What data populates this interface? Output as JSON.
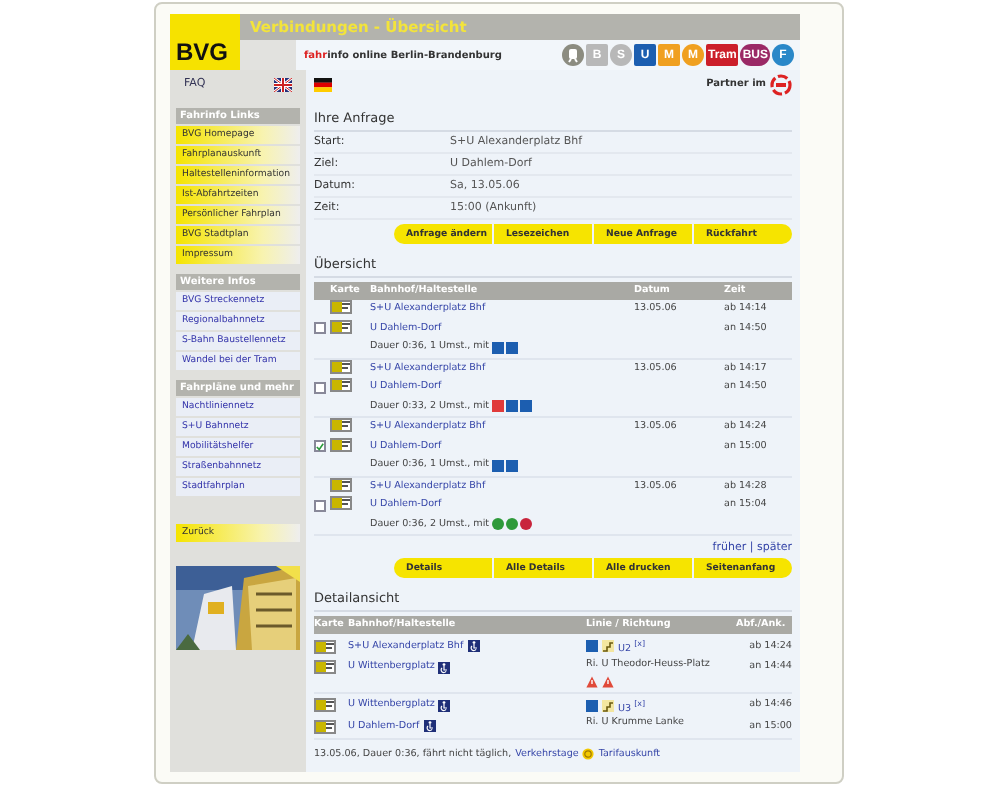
{
  "header": {
    "logo": "BVG",
    "title": "Verbindungen - Übersicht",
    "tagline_brand": "fahr",
    "tagline": "info online Berlin-Brandenburg",
    "modes": [
      {
        "kind": "train",
        "color": "#8c8c80"
      },
      {
        "kind": "square",
        "label": "B",
        "color": "#b8b8b8"
      },
      {
        "kind": "circle",
        "label": "S",
        "color": "#b8b8b8"
      },
      {
        "kind": "square",
        "label": "U",
        "color": "#1c5eb0"
      },
      {
        "kind": "square",
        "label": "M",
        "color": "#f0a020"
      },
      {
        "kind": "circle",
        "label": "M",
        "color": "#f0a020"
      },
      {
        "kind": "square",
        "label": "Tram",
        "color": "#cc1f2a"
      },
      {
        "kind": "circle",
        "label": "BUS",
        "color": "#9b2a66"
      },
      {
        "kind": "circle",
        "label": "F",
        "color": "#2a88c8"
      }
    ],
    "faq": "FAQ",
    "partner": "Partner im"
  },
  "sidebar": {
    "sections": [
      {
        "title": "Fahrinfo Links",
        "kind": "highlight",
        "items": [
          "BVG Homepage",
          "Fahrplanauskunft",
          "Haltestelleninformation",
          "Ist-Abfahrtzeiten",
          "Persönlicher Fahrplan",
          "BVG Stadtplan",
          "Impressum"
        ]
      },
      {
        "title": "Weitere Infos",
        "kind": "link",
        "items": [
          "BVG Streckennetz",
          "Regionalbahnnetz",
          "S-Bahn Baustellennetz",
          "Wandel bei der Tram"
        ]
      },
      {
        "title": "Fahrpläne und mehr",
        "kind": "link",
        "items": [
          "Nachtliniennetz",
          "S+U Bahnnetz",
          "Mobilitätshelfer",
          "Straßenbahnnetz",
          "Stadtfahrplan"
        ]
      }
    ],
    "back": "Zurück"
  },
  "request": {
    "title": "Ihre Anfrage",
    "fields": [
      {
        "label": "Start:",
        "value": "S+U Alexanderplatz Bhf"
      },
      {
        "label": "Ziel:",
        "value": "U Dahlem-Dorf"
      },
      {
        "label": "Datum:",
        "value": "Sa, 13.05.06"
      },
      {
        "label": "Zeit:",
        "value": "15:00 (Ankunft)"
      }
    ],
    "buttons": [
      "Anfrage ändern",
      "Lesezeichen",
      "Neue Anfrage",
      "Rückfahrt"
    ]
  },
  "overview": {
    "title": "Übersicht",
    "columns": [
      "Karte",
      "Bahnhof/Haltestelle",
      "Datum",
      "Zeit"
    ],
    "rows": [
      {
        "checked": false,
        "from": "S+U Alexanderplatz Bhf",
        "to": "U Dahlem-Dorf",
        "date": "13.05.06",
        "dep": "ab 14:14",
        "arr": "an 14:50",
        "summary": "Dauer 0:36, 1 Umst., mit",
        "lines": [
          {
            "kind": "square",
            "color": "#1c5eb0"
          },
          {
            "kind": "square",
            "color": "#1c5eb0"
          }
        ]
      },
      {
        "checked": false,
        "from": "S+U Alexanderplatz Bhf",
        "to": "U Dahlem-Dorf",
        "date": "13.05.06",
        "dep": "ab 14:17",
        "arr": "an 14:50",
        "summary": "Dauer 0:33, 2 Umst., mit",
        "lines": [
          {
            "kind": "square",
            "color": "#e03a3a"
          },
          {
            "kind": "square",
            "color": "#1c5eb0"
          },
          {
            "kind": "square",
            "color": "#1c5eb0"
          }
        ]
      },
      {
        "checked": true,
        "from": "S+U Alexanderplatz Bhf",
        "to": "U Dahlem-Dorf",
        "date": "13.05.06",
        "dep": "ab 14:24",
        "arr": "an 15:00",
        "summary": "Dauer 0:36, 1 Umst., mit",
        "lines": [
          {
            "kind": "square",
            "color": "#1c5eb0"
          },
          {
            "kind": "square",
            "color": "#1c5eb0"
          }
        ]
      },
      {
        "checked": false,
        "from": "S+U Alexanderplatz Bhf",
        "to": "U Dahlem-Dorf",
        "date": "13.05.06",
        "dep": "ab 14:28",
        "arr": "an 15:04",
        "summary": "Dauer 0:36, 2 Umst., mit",
        "lines": [
          {
            "kind": "circle",
            "color": "#2e9a3a"
          },
          {
            "kind": "circle",
            "color": "#2e9a3a"
          },
          {
            "kind": "circle",
            "color": "#c8243c"
          }
        ]
      }
    ],
    "earlier": "früher",
    "separator": "|",
    "later": "später",
    "buttons": [
      "Details",
      "Alle Details",
      "Alle drucken",
      "Seitenanfang"
    ]
  },
  "detail": {
    "title": "Detailansicht",
    "columns": [
      "Karte",
      "Bahnhof/Haltestelle",
      "Linie / Richtung",
      "Abf./Ank."
    ],
    "legs": [
      {
        "from": "S+U Alexanderplatz Bhf",
        "line": "U2 $^{[x]}$",
        "dep": "ab 14:24",
        "to": "U Wittenbergplatz",
        "direction": "Ri. U Theodor-Heuss-Platz",
        "arr": "an 14:44",
        "alerts": [
          {
            "kind": "warning"
          },
          {
            "kind": "warning"
          }
        ]
      },
      {
        "from": "U Wittenbergplatz",
        "line": "U3 $^{[x]}$",
        "dep": "ab 14:46",
        "to": "U Dahlem-Dorf",
        "direction": "Ri. U Krumme Lanke",
        "arr": "an 15:00"
      }
    ],
    "footer": "13.05.06, Dauer 0:36, fährt nicht täglich,",
    "days_link": "Verkehrstage",
    "fare_link": "Tarifauskunft"
  }
}
